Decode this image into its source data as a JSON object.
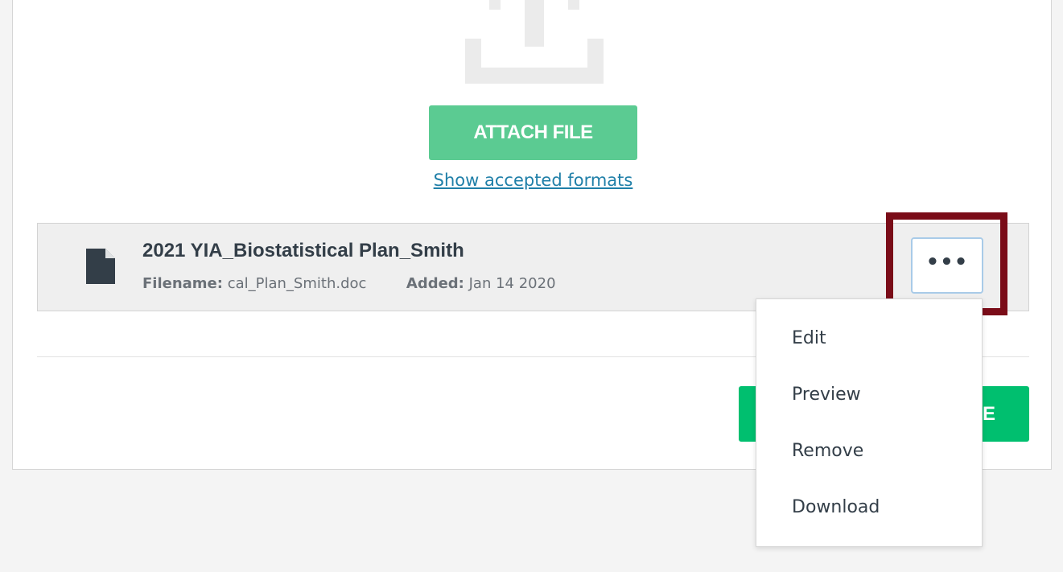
{
  "upload": {
    "icon": "upload-icon",
    "attach_label": "ATTACH FILE",
    "formats_link": "Show accepted formats"
  },
  "file": {
    "icon": "document-icon",
    "title": "2021 YIA_Biostatistical Plan_Smith",
    "filename_label": "Filename:",
    "filename_value": "cal_Plan_Smith.doc",
    "added_label": "Added:",
    "added_value": "Jan 14 2020",
    "more_label": "•••"
  },
  "footer": {
    "save_partial_label": "E"
  },
  "menu": {
    "items": [
      {
        "label": "Edit"
      },
      {
        "label": "Preview"
      },
      {
        "label": "Remove"
      },
      {
        "label": "Download"
      }
    ]
  },
  "colors": {
    "attach_green": "#5bcb92",
    "save_green": "#00bf6f",
    "link_blue": "#1f7fa8",
    "highlight": "#7a0c18"
  }
}
